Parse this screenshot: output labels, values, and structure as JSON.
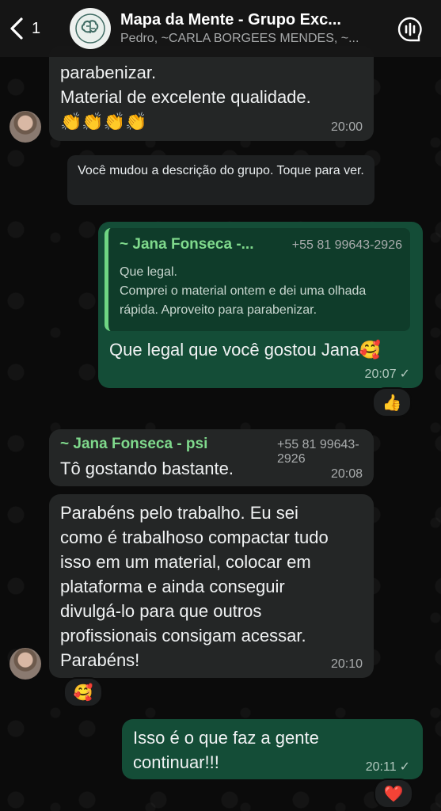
{
  "header": {
    "back_count": "1",
    "title": "Mapa da Mente - Grupo Exc...",
    "subtitle": "Pedro, ~CARLA BORGEES MENDES, ~..."
  },
  "messages": {
    "m1": {
      "partial_line": "parabenizar.",
      "line2": "Material de excelente qualidade.",
      "emojis": "👏👏👏👏",
      "time": "20:00"
    },
    "system": "Você mudou a descrição do grupo. Toque para ver.",
    "m2": {
      "quote_sender": "~ Jana Fonseca -...",
      "quote_phone": "+55 81 99643-2926",
      "quote_text": "Que legal.\nComprei o material ontem e dei uma olhada rápida. Aproveito para parabenizar.",
      "text": "Que legal que você gostou Jana🥰",
      "time": "20:07",
      "tick": "✓",
      "reaction": "👍"
    },
    "m3": {
      "sender": "~ Jana Fonseca - psi",
      "phone": "+55 81 99643-2926",
      "text": "Tô gostando bastante.",
      "time": "20:08"
    },
    "m4": {
      "text": "Parabéns pelo trabalho. Eu sei\ncomo é trabalhoso compactar tudo\nisso em um material, colocar em\nplataforma e ainda conseguir\ndivulgá-lo para que outros\nprofissionais consigam acessar.\nParabéns!",
      "time": "20:10",
      "reaction": "🥰"
    },
    "m5": {
      "text": "Isso é o que faz a gente\ncontinuar!!!",
      "time": "20:11",
      "tick": "✓",
      "reaction": "❤️"
    }
  },
  "colors": {
    "incoming": "#242626",
    "outgoing": "#144d37",
    "sender_green": "#7fd98c"
  }
}
